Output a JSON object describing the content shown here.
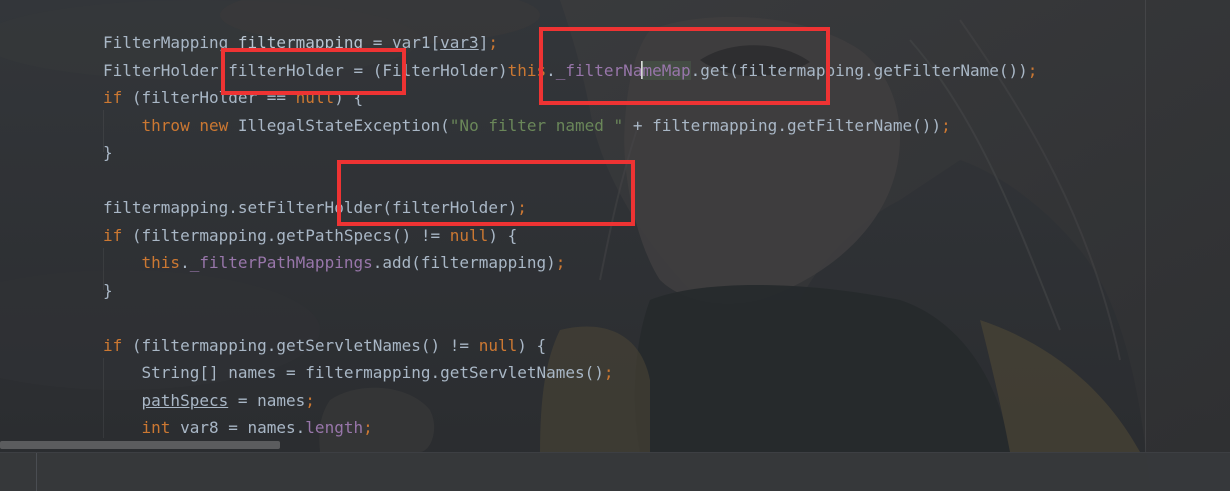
{
  "editor": {
    "lines": [
      {
        "tokens": [
          {
            "t": "FilterMapping "
          },
          {
            "t": "filtermapping",
            "c": "lv"
          },
          {
            "t": " = var1["
          },
          {
            "t": "var3",
            "c": "ul"
          },
          {
            "t": "]"
          },
          {
            "t": ";",
            "c": "kw"
          }
        ]
      },
      {
        "tokens": [
          {
            "t": "FilterHolder filterHolder = (FilterHolder)"
          },
          {
            "t": "this",
            "c": "kw"
          },
          {
            "t": "."
          },
          {
            "t": "_filterNa",
            "c": "fld"
          },
          {
            "caret": true
          },
          {
            "t": "meMap",
            "c": "fld hl"
          },
          {
            "t": ".get(filtermapping.getFilterName())"
          },
          {
            "t": ";",
            "c": "kw"
          }
        ]
      },
      {
        "tokens": [
          {
            "t": "if",
            "c": "kw"
          },
          {
            "t": " (filterHolder == "
          },
          {
            "t": "null",
            "c": "kw"
          },
          {
            "t": ") {"
          }
        ]
      },
      {
        "tokens": [
          {
            "t": "    "
          },
          {
            "t": "throw new",
            "c": "kw"
          },
          {
            "t": " IllegalStateException("
          },
          {
            "t": "\"No filter named \"",
            "c": "str"
          },
          {
            "t": " + filtermapping.getFilterName())"
          },
          {
            "t": ";",
            "c": "kw"
          }
        ]
      },
      {
        "tokens": [
          {
            "t": "}"
          }
        ]
      },
      {
        "tokens": [
          {
            "t": ""
          }
        ]
      },
      {
        "tokens": [
          {
            "t": "filtermapping.setFilterHolder(filterHolder)"
          },
          {
            "t": ";",
            "c": "kw"
          }
        ]
      },
      {
        "tokens": [
          {
            "t": "if",
            "c": "kw"
          },
          {
            "t": " (filtermapping.getPathSpecs() != "
          },
          {
            "t": "null",
            "c": "kw"
          },
          {
            "t": ") {"
          }
        ]
      },
      {
        "tokens": [
          {
            "t": "    "
          },
          {
            "t": "this",
            "c": "kw"
          },
          {
            "t": "."
          },
          {
            "t": "_filterPathMappings",
            "c": "fld"
          },
          {
            "t": ".add(filtermapping)"
          },
          {
            "t": ";",
            "c": "kw"
          }
        ]
      },
      {
        "tokens": [
          {
            "t": "}"
          }
        ]
      },
      {
        "tokens": [
          {
            "t": ""
          }
        ]
      },
      {
        "tokens": [
          {
            "t": "if",
            "c": "kw"
          },
          {
            "t": " (filtermapping.getServletNames() != "
          },
          {
            "t": "null",
            "c": "kw"
          },
          {
            "t": ") {"
          }
        ]
      },
      {
        "tokens": [
          {
            "t": "    String[] names = filtermapping.getServletNames()"
          },
          {
            "t": ";",
            "c": "kw"
          }
        ]
      },
      {
        "tokens": [
          {
            "t": "    "
          },
          {
            "t": "pathSpecs",
            "c": "ul"
          },
          {
            "t": " = names"
          },
          {
            "t": ";",
            "c": "kw"
          }
        ]
      },
      {
        "tokens": [
          {
            "t": "    "
          },
          {
            "t": "int",
            "c": "kw"
          },
          {
            "t": " var8 = names."
          },
          {
            "t": "length",
            "c": "fld"
          },
          {
            "t": ";",
            "c": "kw"
          }
        ]
      }
    ]
  },
  "annotations": {
    "color": "#ee3333",
    "boxes": [
      "filterHolder",
      "_filterNameMap.get(filtermapping",
      "setFilterHolder"
    ]
  },
  "theme": {
    "keyword": "#cc7832",
    "field": "#9876aa",
    "string": "#6a8759",
    "text": "#a9b7c6"
  }
}
